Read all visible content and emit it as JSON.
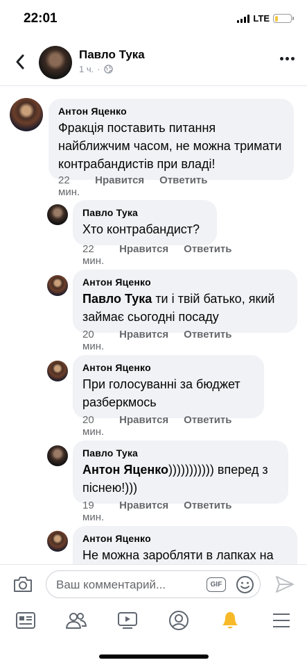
{
  "status_bar": {
    "time": "22:01",
    "network": "LTE"
  },
  "header": {
    "name": "Павло Тука",
    "time": "1 ч.",
    "separator": "·"
  },
  "comments": [
    {
      "author": "Антон Яценко",
      "text": "Фракція поставить питання найближчим часом, не можна тримати контрабандистів при владі!",
      "time": "22 мин.",
      "like": "Нравится",
      "reply": "Ответить"
    },
    {
      "author": "Павло Тука",
      "text": "Хто контрабандист?",
      "time": "22 мин.",
      "like": "Нравится",
      "reply": "Ответить"
    },
    {
      "author": "Антон Яценко",
      "mention": "Павло Тука",
      "text": " ти і твій батько, який займає сьогодні посаду",
      "time": "20 мин.",
      "like": "Нравится",
      "reply": "Ответить"
    },
    {
      "author": "Антон Яценко",
      "text": "При голосуванні за бюджет разберкмось",
      "time": "20 мин.",
      "like": "Нравится",
      "reply": "Ответить"
    },
    {
      "author": "Павло Тука",
      "mention": "Антон Яценко",
      "text": "))))))))))) вперед з піснею!)))",
      "time": "19 мин.",
      "like": "Нравится",
      "reply": "Ответить"
    },
    {
      "author": "Антон Яценко",
      "text": "Не можна заробляти в лапках на"
    }
  ],
  "composer": {
    "placeholder": "Ваш комментарий...",
    "gif_label": "GIF"
  },
  "tabbar": {
    "icons": [
      "feed-icon",
      "friends-icon",
      "watch-icon",
      "profile-icon",
      "notifications-bell-icon",
      "menu-icon"
    ],
    "active_color": "#f7b928"
  },
  "colors": {
    "bubble": "#f0f2f5",
    "meta": "#65676b",
    "text": "#050505"
  }
}
